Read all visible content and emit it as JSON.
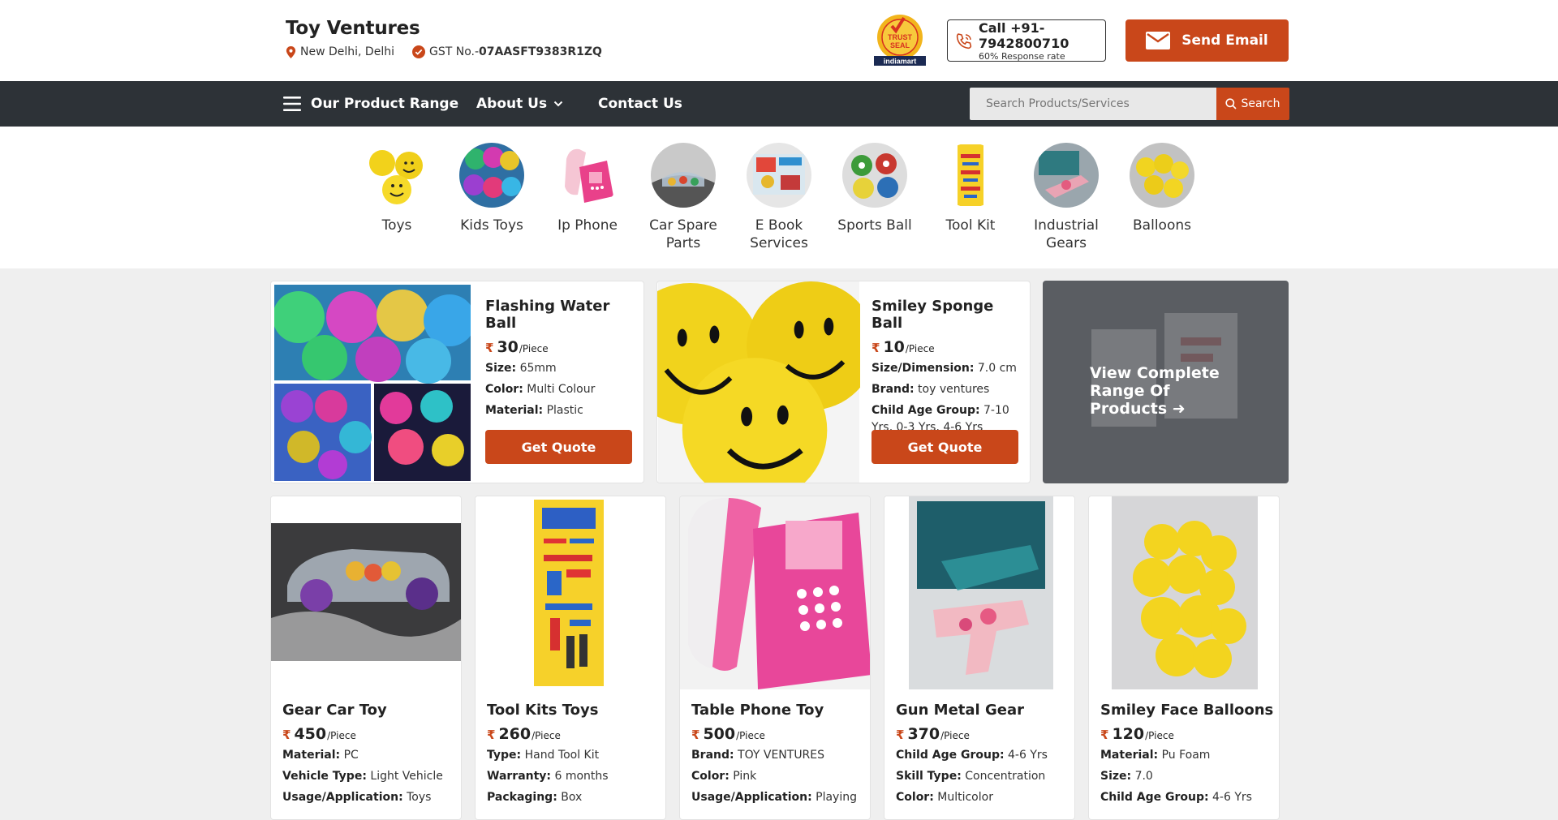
{
  "header": {
    "company": "Toy Ventures",
    "location": "New Delhi, Delhi",
    "gst_label": "GST No.-",
    "gst_value": "07AASFT9383R1ZQ",
    "seal_top": "TRUST",
    "seal_mid": "SEAL",
    "seal_brand": "indiamart",
    "call_label": "Call +91-7942800710",
    "response_rate": "60% Response rate",
    "email_label": "Send Email"
  },
  "nav": {
    "product_range": "Our Product Range",
    "about": "About Us",
    "contact": "Contact Us",
    "search_placeholder": "Search Products/Services",
    "search_button": "Search"
  },
  "categories": [
    {
      "label": "Toys"
    },
    {
      "label": "Kids Toys"
    },
    {
      "label": "Ip Phone"
    },
    {
      "label": "Car Spare Parts"
    },
    {
      "label": "E Book Services"
    },
    {
      "label": "Sports Ball"
    },
    {
      "label": "Tool Kit"
    },
    {
      "label": "Industrial Gears"
    },
    {
      "label": "Balloons"
    }
  ],
  "featured": [
    {
      "title": "Flashing Water Ball",
      "currency": "₹",
      "price": "30",
      "unit": "/Piece",
      "specs": [
        {
          "k": "Size:",
          "v": " 65mm"
        },
        {
          "k": "Color:",
          "v": " Multi Colour"
        },
        {
          "k": "Material:",
          "v": " Plastic"
        }
      ],
      "cta": "Get Quote"
    },
    {
      "title": "Smiley Sponge Ball",
      "currency": "₹",
      "price": "10",
      "unit": "/Piece",
      "specs": [
        {
          "k": "Size/Dimension:",
          "v": " 7.0 cm"
        },
        {
          "k": "Brand:",
          "v": " toy ventures"
        },
        {
          "k": "Child Age Group:",
          "v": " 7-10 Yrs, 0-3 Yrs, 4-6 Yrs"
        }
      ],
      "cta": "Get Quote"
    }
  ],
  "view_all": "View Complete Range Of Products ➜",
  "products": [
    {
      "title": "Gear Car Toy",
      "currency": "₹",
      "price": "450",
      "unit": "/Piece",
      "specs": [
        {
          "k": "Material:",
          "v": " PC"
        },
        {
          "k": "Vehicle Type:",
          "v": " Light Vehicle"
        },
        {
          "k": "Usage/Application:",
          "v": " Toys"
        }
      ]
    },
    {
      "title": "Tool Kits Toys",
      "currency": "₹",
      "price": "260",
      "unit": "/Piece",
      "specs": [
        {
          "k": "Type:",
          "v": " Hand Tool Kit"
        },
        {
          "k": "Warranty:",
          "v": " 6 months"
        },
        {
          "k": "Packaging:",
          "v": " Box"
        }
      ]
    },
    {
      "title": "Table Phone Toy",
      "currency": "₹",
      "price": "500",
      "unit": "/Piece",
      "specs": [
        {
          "k": "Brand:",
          "v": " TOY VENTURES"
        },
        {
          "k": "Color:",
          "v": " Pink"
        },
        {
          "k": "Usage/Application:",
          "v": " Playing"
        }
      ]
    },
    {
      "title": "Gun Metal Gear",
      "currency": "₹",
      "price": "370",
      "unit": "/Piece",
      "specs": [
        {
          "k": "Child Age Group:",
          "v": " 4-6 Yrs"
        },
        {
          "k": "Skill Type:",
          "v": " Concentration"
        },
        {
          "k": "Color:",
          "v": " Multicolor"
        }
      ]
    },
    {
      "title": "Smiley Face Balloons",
      "currency": "₹",
      "price": "120",
      "unit": "/Piece",
      "specs": [
        {
          "k": "Material:",
          "v": " Pu Foam"
        },
        {
          "k": "Size:",
          "v": " 7.0"
        },
        {
          "k": "Child Age Group:",
          "v": " 4-6 Yrs"
        }
      ]
    }
  ],
  "colors": {
    "accent": "#c9471a",
    "nav_bg": "#2d3237",
    "page_bg": "#efefef"
  }
}
